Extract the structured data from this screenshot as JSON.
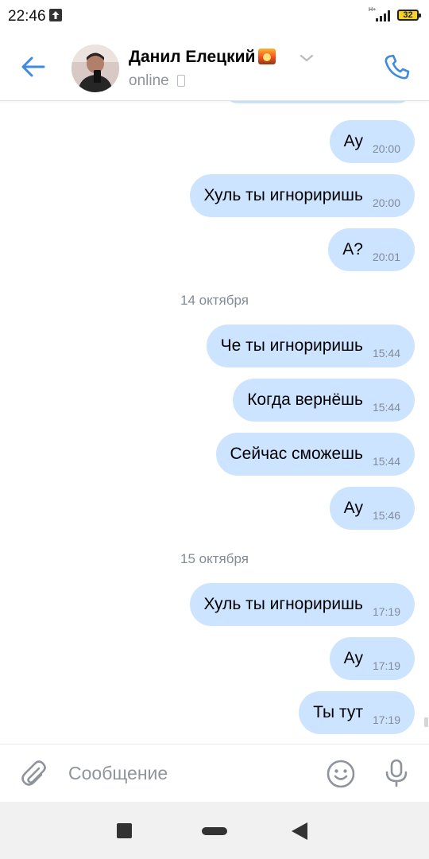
{
  "status_bar": {
    "time": "22:46",
    "network": "H+",
    "battery": "32"
  },
  "header": {
    "contact_name": "Данил Елецкий",
    "status": "online"
  },
  "messages": [
    {
      "text": "Ау",
      "time": "20:00"
    },
    {
      "text": "Хуль ты игнориришь",
      "time": "20:00"
    },
    {
      "text": "А?",
      "time": "20:01"
    },
    {
      "date": "14 октября"
    },
    {
      "text": "Че ты игнориришь",
      "time": "15:44"
    },
    {
      "text": "Когда вернёшь",
      "time": "15:44"
    },
    {
      "text": "Сейчас сможешь",
      "time": "15:44"
    },
    {
      "text": "Ау",
      "time": "15:46"
    },
    {
      "date": "15 октября"
    },
    {
      "text": "Хуль ты игнориришь",
      "time": "17:19"
    },
    {
      "text": "Ау",
      "time": "17:19"
    },
    {
      "text": "Ты тут",
      "time": "17:19"
    }
  ],
  "composer": {
    "placeholder": "Сообщение"
  },
  "icons": {
    "back": "arrow-left-icon",
    "phone": "phone-icon",
    "attach": "paperclip-icon",
    "emoji": "smile-icon",
    "mic": "microphone-icon",
    "chevron": "chevron-down-icon"
  },
  "colors": {
    "accent": "#3f8ae0",
    "bubble": "#cce4ff",
    "secondary_text": "#828b96"
  }
}
